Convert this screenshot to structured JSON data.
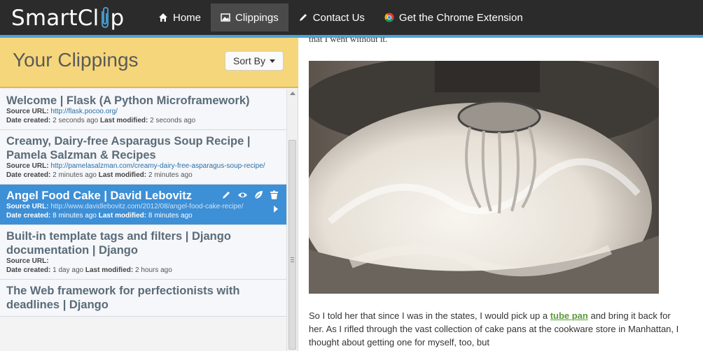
{
  "brand": {
    "name_prefix": "SmartCl",
    "name_suffix": "p"
  },
  "nav": [
    {
      "label": "Home",
      "icon": "home-icon"
    },
    {
      "label": "Clippings",
      "icon": "image-icon"
    },
    {
      "label": "Contact Us",
      "icon": "pencil-icon"
    },
    {
      "label": "Get the Chrome Extension",
      "icon": "chrome-icon"
    }
  ],
  "sidebar": {
    "title": "Your Clippings",
    "sort_label": "Sort By",
    "labels": {
      "source": "Source URL:",
      "created": "Date created:",
      "modified": "Last modified:"
    },
    "items": [
      {
        "title": "Welcome | Flask (A Python Microframework)",
        "url": "http://flask.pocoo.org/",
        "created": "2 seconds ago",
        "modified": "2 seconds ago"
      },
      {
        "title": "Creamy, Dairy-free Asparagus Soup Recipe | Pamela Salzman & Recipes",
        "url": "http://pamelasalzman.com/creamy-dairy-free-asparagus-soup-recipe/",
        "created": "2 minutes ago",
        "modified": "2 minutes ago"
      },
      {
        "title": "Angel Food Cake | David Lebovitz",
        "url": "http://www.davidlebovitz.com/2012/08/angel-food-cake-recipe/",
        "created": "8 minutes ago",
        "modified": "8 minutes ago"
      },
      {
        "title": "Built-in template tags and filters | Django documentation | Django",
        "url": "",
        "created": "1 day ago",
        "modified": "2 hours ago"
      },
      {
        "title": "The Web framework for perfectionists with deadlines | Django",
        "url": "",
        "created": "",
        "modified": ""
      }
    ]
  },
  "content": {
    "cut_line": "that I went without it.",
    "para_before": "So I told her that since I was in the states, I would pick up a ",
    "link": "tube pan",
    "para_after": " and bring it back for her. As I rifled through the vast collection of cake pans at the cookware store in Manhattan, I thought about getting one for myself, too, but"
  },
  "colors": {
    "accent": "#4aa3d8",
    "header_yellow": "#f6d67a",
    "selected": "#3d8fd6",
    "link_green": "#5a9a3a"
  }
}
